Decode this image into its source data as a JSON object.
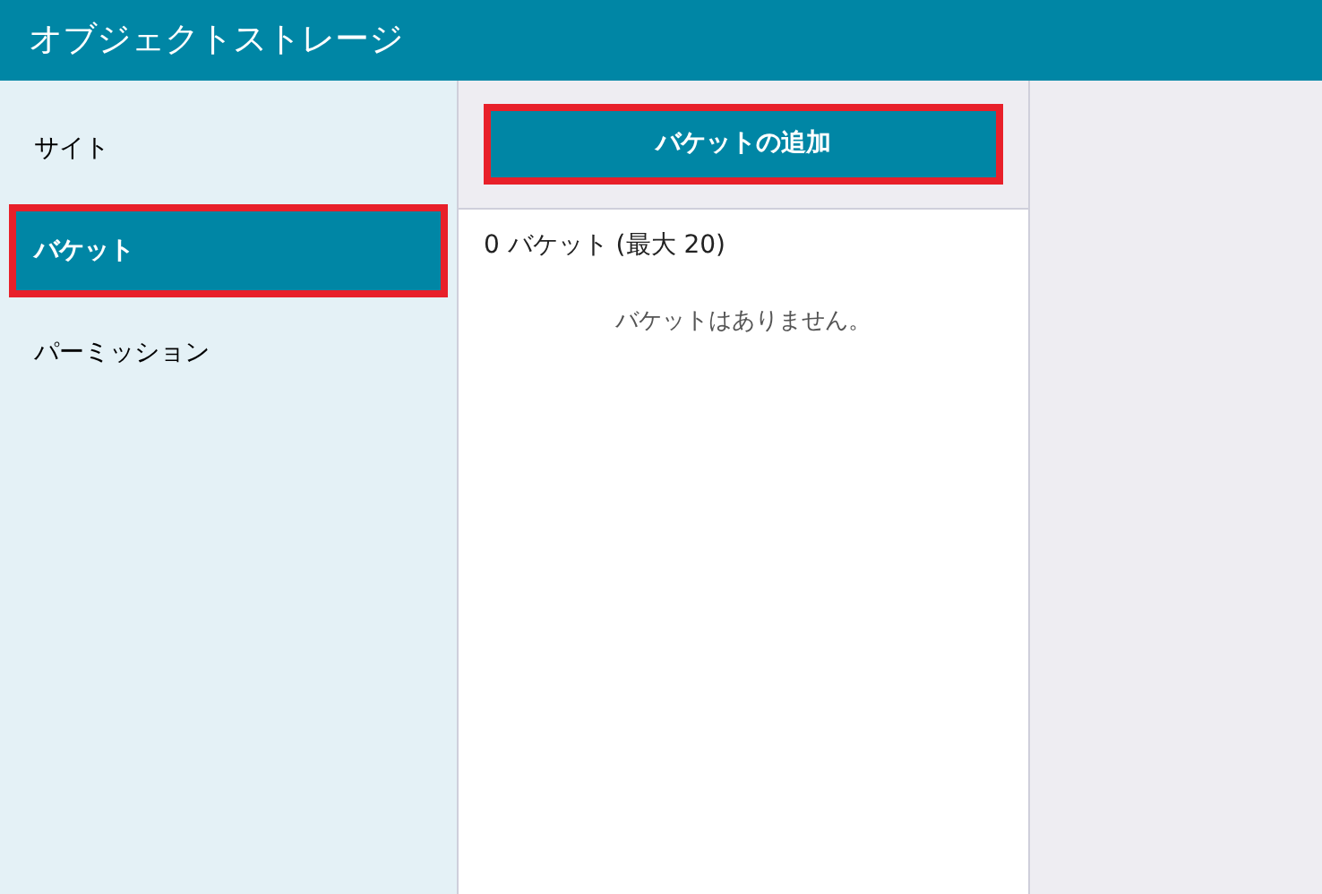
{
  "header": {
    "title": "オブジェクトストレージ"
  },
  "sidebar": {
    "items": [
      {
        "label": "サイト",
        "selected": false,
        "highlighted": false
      },
      {
        "label": "バケット",
        "selected": true,
        "highlighted": true
      },
      {
        "label": "パーミッション",
        "selected": false,
        "highlighted": false
      }
    ]
  },
  "toolbar": {
    "add_button": {
      "label": "バケットの追加",
      "highlighted": true
    }
  },
  "bucket_list": {
    "count": "0 バケット (最大 20)",
    "empty_message": "バケットはありません。"
  }
}
